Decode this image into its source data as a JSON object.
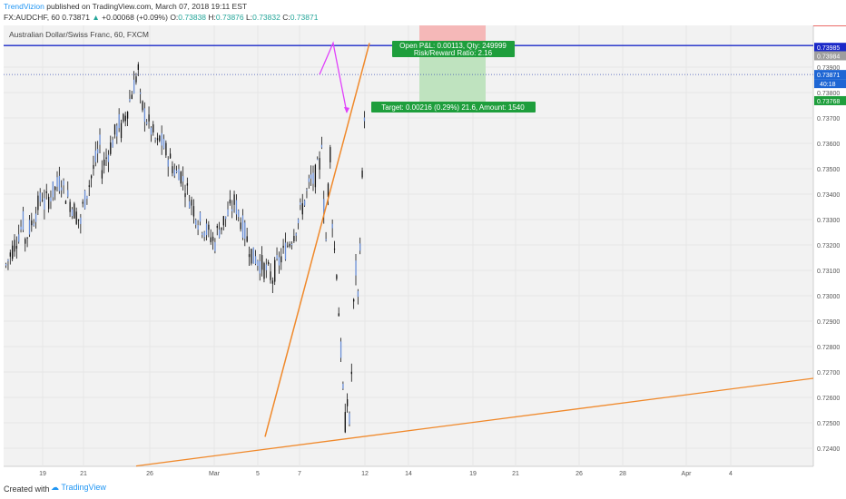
{
  "header": {
    "brand": "TrendVizion",
    "published_text": " published on TradingView.com, March 07, 2018 19:11 EST",
    "symbol": "FX:AUDCHF, 60",
    "last": "0.73871",
    "change_arrow": "▲",
    "change": "+0.00068 (+0.09%)",
    "o_label": "O:",
    "o": "0.73838",
    "h_label": "H:",
    "h": "0.73876",
    "l_label": "L:",
    "l": "0.73832",
    "c_label": "C:",
    "c": "0.73871"
  },
  "footer": {
    "created": "Created with",
    "brand": "TradingView"
  },
  "chart_data": {
    "type": "candlestick",
    "title": "Australian Dollar/Swiss Franc, 60, FXCM",
    "x_ticks": [
      "19",
      "21",
      "26",
      "Mar",
      "5",
      "7",
      "12",
      "14",
      "19",
      "21",
      "26",
      "28",
      "Apr",
      "4"
    ],
    "y_ticks": [
      "0.73900",
      "0.73800",
      "0.73700",
      "0.73600",
      "0.73500",
      "0.73400",
      "0.73300",
      "0.73200",
      "0.73100",
      "0.73000",
      "0.72900",
      "0.72800",
      "0.72700",
      "0.72600",
      "0.72500",
      "0.72400"
    ],
    "ylim": [
      0.7233,
      0.7404
    ],
    "price_tags": [
      {
        "value": "0.73985",
        "role": "resistance"
      },
      {
        "value": "0.73984",
        "role": "gray"
      },
      {
        "value": "0.73871",
        "role": "last"
      },
      {
        "value": "40:18",
        "role": "countdown"
      },
      {
        "value": "0.73768",
        "role": "target"
      }
    ],
    "position": {
      "label1": "Open P&L: 0.00113, Qty: 249999",
      "label2": "Risk/Reward Ratio: 2.16",
      "target_label": "Target: 0.00216 (0.29%) 21.6, Amount: 1540"
    },
    "price_path": [
      [
        0.7312,
        0.7331
      ],
      [
        0.7322,
        0.7342
      ],
      [
        0.7336,
        0.7347
      ],
      [
        0.7342,
        0.7327
      ],
      [
        0.7335,
        0.7362
      ],
      [
        0.735,
        0.737
      ],
      [
        0.7365,
        0.7392
      ],
      [
        0.7376,
        0.7357
      ],
      [
        0.7362,
        0.7346
      ],
      [
        0.735,
        0.733
      ],
      [
        0.733,
        0.732
      ],
      [
        0.7325,
        0.7338
      ],
      [
        0.7335,
        0.7312
      ],
      [
        0.7315,
        0.7306
      ],
      [
        0.731,
        0.7325
      ],
      [
        0.7325,
        0.7348
      ],
      [
        0.7345,
        0.7365
      ],
      [
        0.7362,
        0.7335
      ],
      [
        0.7335,
        0.7322
      ],
      [
        0.7322,
        0.7344
      ],
      [
        0.7342,
        0.736
      ],
      [
        0.7357,
        0.733
      ],
      [
        0.733,
        0.7316
      ],
      [
        0.7318,
        0.7306
      ],
      [
        0.731,
        0.7294
      ],
      [
        0.7294,
        0.7276
      ],
      [
        0.7278,
        0.7258
      ],
      [
        0.7262,
        0.7244
      ],
      [
        0.725,
        0.7262
      ],
      [
        0.726,
        0.725
      ],
      [
        0.725,
        0.7272
      ],
      [
        0.727,
        0.7296
      ],
      [
        0.7296,
        0.7312
      ],
      [
        0.731,
        0.7298
      ],
      [
        0.7298,
        0.7326
      ],
      [
        0.7322,
        0.7348
      ],
      [
        0.7346,
        0.7376
      ],
      [
        0.7372,
        0.7387
      ]
    ],
    "trendlines": [
      {
        "name": "steep-trendline",
        "x": [
          11.3,
          18.5
        ],
        "y": [
          0.72445,
          0.73995
        ]
      },
      {
        "name": "long-trendline",
        "x": [
          7.0,
          42.0
        ],
        "y": [
          0.7233,
          0.72675
        ]
      }
    ],
    "projection": {
      "x": [
        15.8,
        16.4,
        17.3
      ],
      "y": [
        0.73871,
        0.73995,
        0.73722
      ]
    },
    "levels": [
      {
        "name": "resistance",
        "value": 0.73985
      },
      {
        "name": "last-price",
        "value": 0.73871
      }
    ]
  }
}
